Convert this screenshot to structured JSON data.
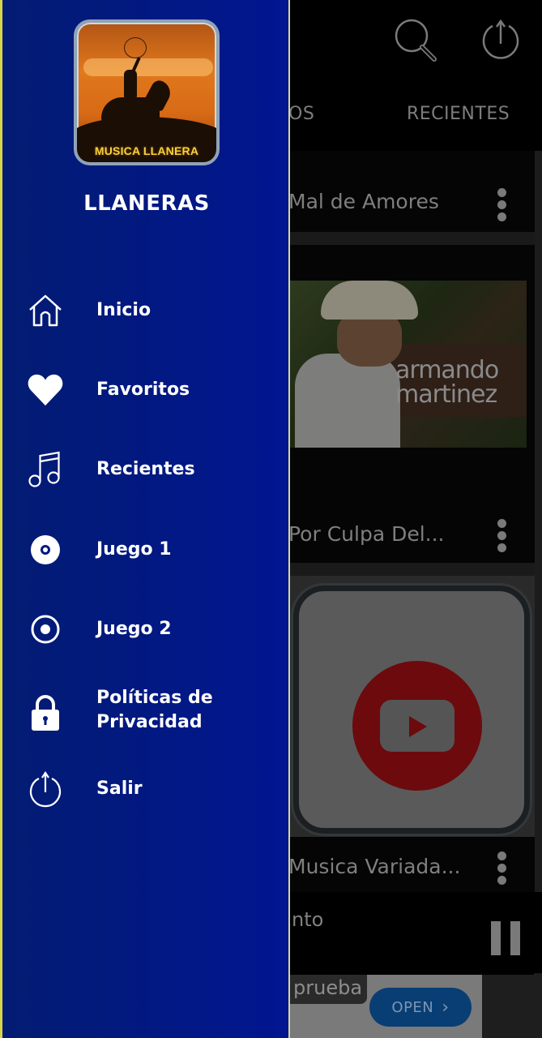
{
  "app": {
    "header": {
      "search_icon": "search-icon",
      "power_icon": "power-icon"
    },
    "tabs": [
      {
        "label": "OS"
      },
      {
        "label": "RECIENTES"
      }
    ],
    "list": [
      {
        "title": "Mal de Amores"
      },
      {
        "title": "Por Culpa Del...",
        "thumbnail_text": "armando\nmartinez"
      },
      {
        "title": "Musica Variada..."
      }
    ],
    "player": {
      "track_text": "nto",
      "state": "playing"
    },
    "ad": {
      "tag": "prueba",
      "cta_label": "OPEN",
      "cta_arrow": "›"
    }
  },
  "drawer": {
    "logo_text": "MUSICA LLANERA",
    "title": "LLANERAS",
    "items": [
      {
        "label": "Inicio",
        "icon": "home-icon"
      },
      {
        "label": "Favoritos",
        "icon": "heart-icon"
      },
      {
        "label": "Recientes",
        "icon": "music-note-icon"
      },
      {
        "label": "Juego 1",
        "icon": "disc-icon"
      },
      {
        "label": "Juego 2",
        "icon": "radio-button-icon"
      },
      {
        "label": "Políticas de Privacidad",
        "label_line1": "Políticas de",
        "label_line2": "Privacidad",
        "icon": "lock-icon"
      },
      {
        "label": "Salir",
        "icon": "power-icon"
      }
    ]
  },
  "colors": {
    "drawer_bg": "#02197e",
    "drawer_edge": "#d8d44a",
    "text_primary": "#ffffff",
    "dim_text": "#7f7f7f",
    "ad_button": "#083e74"
  }
}
